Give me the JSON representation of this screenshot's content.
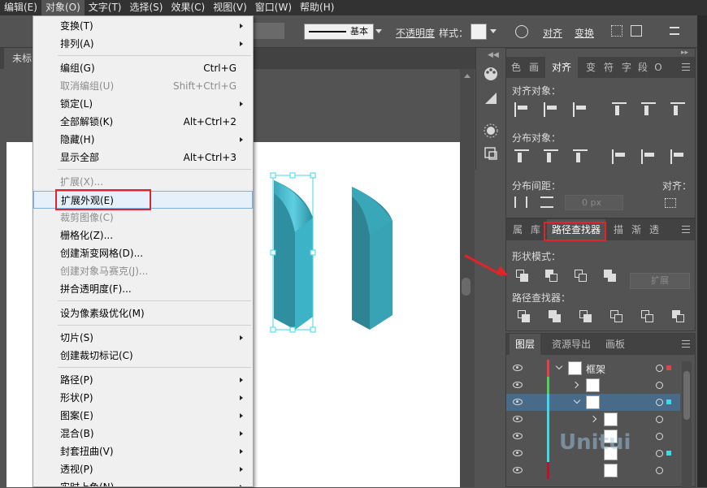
{
  "menubar": {
    "items": [
      "编辑(E)",
      "对象(O)",
      "文字(T)",
      "选择(S)",
      "效果(C)",
      "视图(V)",
      "窗口(W)",
      "帮助(H)"
    ],
    "active_index": 1
  },
  "controlbar": {
    "stroke_style": "基本",
    "opacity_label": "不透明度",
    "style_label": "样式：",
    "align_label": "对齐",
    "transform_label": "变换"
  },
  "document": {
    "tab_label": "未标"
  },
  "object_menu": {
    "items": [
      {
        "label": "变换(T)",
        "shortcut": "",
        "submenu": true,
        "disabled": false
      },
      {
        "label": "排列(A)",
        "shortcut": "",
        "submenu": true,
        "disabled": false
      },
      {
        "label": "编组(G)",
        "shortcut": "Ctrl+G",
        "submenu": false,
        "disabled": false
      },
      {
        "label": "取消编组(U)",
        "shortcut": "Shift+Ctrl+G",
        "submenu": false,
        "disabled": true
      },
      {
        "label": "锁定(L)",
        "shortcut": "",
        "submenu": true,
        "disabled": false
      },
      {
        "label": "全部解锁(K)",
        "shortcut": "Alt+Ctrl+2",
        "submenu": false,
        "disabled": false
      },
      {
        "label": "隐藏(H)",
        "shortcut": "",
        "submenu": true,
        "disabled": false
      },
      {
        "label": "显示全部",
        "shortcut": "Alt+Ctrl+3",
        "submenu": false,
        "disabled": false
      },
      {
        "label": "扩展(X)...",
        "shortcut": "",
        "submenu": false,
        "disabled": true
      },
      {
        "label": "扩展外观(E)",
        "shortcut": "",
        "submenu": false,
        "disabled": false,
        "highlighted": true
      },
      {
        "label": "裁剪图像(C)",
        "shortcut": "",
        "submenu": false,
        "disabled": true
      },
      {
        "label": "栅格化(Z)...",
        "shortcut": "",
        "submenu": false,
        "disabled": false
      },
      {
        "label": "创建渐变网格(D)...",
        "shortcut": "",
        "submenu": false,
        "disabled": false
      },
      {
        "label": "创建对象马赛克(J)...",
        "shortcut": "",
        "submenu": false,
        "disabled": true
      },
      {
        "label": "拼合透明度(F)...",
        "shortcut": "",
        "submenu": false,
        "disabled": false
      },
      {
        "label": "设为像素级优化(M)",
        "shortcut": "",
        "submenu": false,
        "disabled": false
      },
      {
        "label": "切片(S)",
        "shortcut": "",
        "submenu": true,
        "disabled": false
      },
      {
        "label": "创建裁切标记(C)",
        "shortcut": "",
        "submenu": false,
        "disabled": false
      },
      {
        "label": "路径(P)",
        "shortcut": "",
        "submenu": true,
        "disabled": false
      },
      {
        "label": "形状(P)",
        "shortcut": "",
        "submenu": true,
        "disabled": false
      },
      {
        "label": "图案(E)",
        "shortcut": "",
        "submenu": true,
        "disabled": false
      },
      {
        "label": "混合(B)",
        "shortcut": "",
        "submenu": true,
        "disabled": false
      },
      {
        "label": "封套扭曲(V)",
        "shortcut": "",
        "submenu": true,
        "disabled": false
      },
      {
        "label": "透视(P)",
        "shortcut": "",
        "submenu": true,
        "disabled": false
      },
      {
        "label": "实时上色(N)",
        "shortcut": "",
        "submenu": true,
        "disabled": false
      }
    ]
  },
  "align_panel": {
    "tabs": [
      "色",
      "画",
      "对齐",
      "变",
      "符",
      "字",
      "段",
      "O"
    ],
    "active_tab": "对齐",
    "align_objects_label": "对齐对象：",
    "distribute_objects_label": "分布对象：",
    "distribute_spacing_label": "分布间距：",
    "spacing_value": "0 px",
    "align_to_label": "对齐："
  },
  "pathfinder_panel": {
    "tabs": [
      "属",
      "库",
      "路径查找器",
      "描",
      "渐",
      "透"
    ],
    "active_tab": "路径查找器",
    "shape_modes_label": "形状模式：",
    "pathfinders_label": "路径查找器：",
    "expand_button": "扩展"
  },
  "layers_panel": {
    "tabs": [
      "图层",
      "资源导出",
      "画板"
    ],
    "active_tab": "图层",
    "rows": [
      {
        "name": "框架",
        "color": "#e3404a",
        "indent": 0,
        "expanded": true,
        "selected": false
      },
      {
        "name": "",
        "color": "#4fd05a",
        "indent": 1,
        "expanded": false,
        "selected": false
      },
      {
        "name": "",
        "color": "#41d7e6",
        "indent": 1,
        "expanded": true,
        "selected": true
      },
      {
        "name": "",
        "color": "#41d7e6",
        "indent": 2,
        "expanded": false,
        "selected": false
      },
      {
        "name": "",
        "color": "#41d7e6",
        "indent": 2,
        "expanded": null,
        "selected": false
      },
      {
        "name": "",
        "color": "#41d7e6",
        "indent": 2,
        "expanded": null,
        "selected": false
      },
      {
        "name": "",
        "color": "#b8142e",
        "indent": 2,
        "expanded": null,
        "selected": false
      }
    ]
  },
  "watermark": {
    "text": "Unitui"
  },
  "colors": {
    "highlight_box": "#e1242a",
    "shape_teal": "#3aa7b9",
    "selection": "#41d7e6"
  }
}
